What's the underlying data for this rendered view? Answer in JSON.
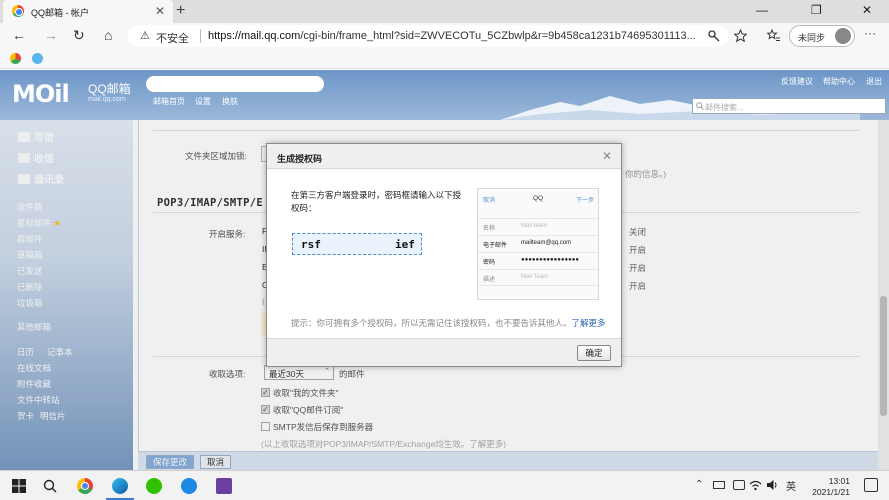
{
  "browser": {
    "tab_title": "QQ邮箱 - 帐户",
    "tab_close": "✕",
    "new_tab": "+",
    "window_controls": [
      "—",
      "❐",
      "✕"
    ],
    "nav": {
      "back": "←",
      "forward": "→",
      "reload": "↻",
      "home": "⌂"
    },
    "security_warning_icon": "⚠",
    "security_label": "不安全",
    "url_host": "https://mail.qq.com",
    "url_path": "/cgi-bin/frame_html?sid=ZWVECOTu_5CZbwlp&r=9b458ca1231b74695301113...",
    "toolbar_icons": [
      "key-icon",
      "star-icon",
      "favorites-icon"
    ],
    "sync_label": "未同步",
    "more": "···"
  },
  "mail_header": {
    "logo_text": "MOil",
    "logo_cn": "QQ邮箱",
    "logo_url": "mail.qq.com",
    "links": [
      "邮箱首页",
      "设置",
      "换肤"
    ],
    "top_links": [
      "反馈建议",
      "帮助中心",
      "退出"
    ],
    "search_placeholder": "邮件搜索..."
  },
  "sidebar": {
    "primary": [
      "写信",
      "收信",
      "通讯录"
    ],
    "folders": [
      "收件箱",
      "星标邮件",
      "群邮件",
      "草稿箱",
      "已发送",
      "已删除",
      "垃圾箱"
    ],
    "other_mail": "其他邮箱",
    "tools_row1": [
      "日历",
      "记事本"
    ],
    "tools": [
      "在线文档",
      "附件收藏",
      "文件中转站"
    ],
    "tools_row2": [
      "贺卡",
      "明信片"
    ]
  },
  "settings": {
    "folder_lock_label": "文件夹区域加锁:",
    "folder_lock_note": "你的信息。)",
    "pop_heading": "POP3/IMAP/SMTP/E",
    "enable_service_label": "开启服务:",
    "services": [
      {
        "code": "P",
        "status": "关闭"
      },
      {
        "code": "IN",
        "status": "开启"
      },
      {
        "code": "E",
        "status": "开启"
      },
      {
        "code": "C",
        "status": "开启"
      }
    ],
    "paren": "(",
    "receive_options_label": "收取选项:",
    "receive_select": "最近30天",
    "receive_suffix": "的邮件",
    "check_options": [
      {
        "label": "收取\"我的文件夹\"",
        "checked": true
      },
      {
        "label": "收取\"QQ邮件订阅\"",
        "checked": true
      },
      {
        "label": "SMTP发信后保存到服务器",
        "checked": false
      }
    ],
    "footnote": "(以上收取选项对POP3/IMAP/SMTP/Exchange均生效。了解更多)",
    "save_button": "保存更改",
    "cancel_button": "取消"
  },
  "dialog": {
    "title": "生成授权码",
    "close": "✕",
    "description": "在第三方客户端登录时，密码框请输入以下授权码：",
    "code_left": "rsf",
    "code_right": "ief",
    "phone": {
      "cancel": "取消",
      "title": "QQ",
      "next": "下一步",
      "rows": [
        {
          "key": "名称",
          "value": "Mail team",
          "filled": false
        },
        {
          "key": "电子邮件",
          "value": "mailteam@qq.com",
          "filled": true
        },
        {
          "key": "密码",
          "value": "●●●●●●●●●●●●●●●●",
          "filled": true
        },
        {
          "key": "描述",
          "value": "Mail Team",
          "filled": false
        }
      ]
    },
    "tip": "提示：你可拥有多个授权码，所以无需记住该授权码，也不要告诉其他人。",
    "tip_link": "了解更多",
    "ok_button": "确定"
  },
  "taskbar": {
    "tray_lang": "英",
    "time": "13:01",
    "date": "2021/1/21"
  }
}
